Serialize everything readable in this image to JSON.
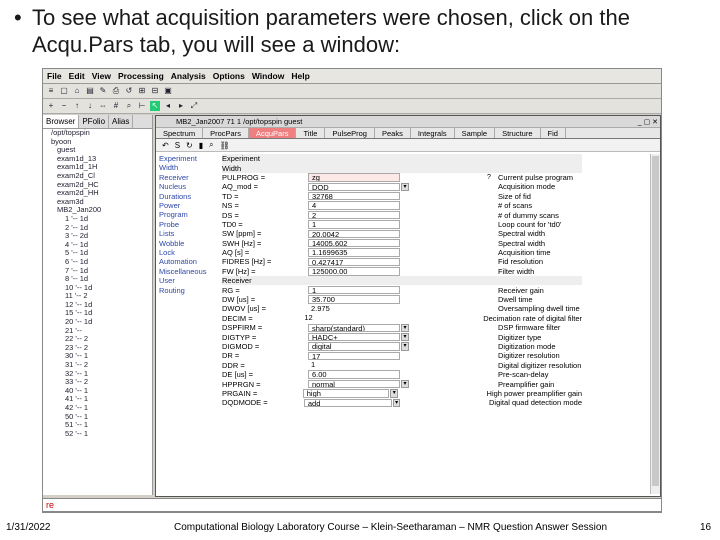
{
  "slide": {
    "bullet": "To see what acquisition parameters were chosen, click on the Acqu.Pars tab, you will see a window:",
    "date": "1/31/2022",
    "footer": "Computational Biology Laboratory Course – Klein-Seetharaman – NMR Question Answer Session",
    "page": "16"
  },
  "app": {
    "menu": [
      "File",
      "Edit",
      "View",
      "Processing",
      "Analysis",
      "Options",
      "Window",
      "Help"
    ],
    "browser_tabs": [
      "Browser",
      "PFolio",
      "Alias"
    ],
    "tree": [
      "/opt/topspin",
      "byoon",
      "guest",
      "exam1d_13",
      "exam1d_1H",
      "exam2d_Cl",
      "exam2d_HC",
      "exam2d_HH",
      "exam3d",
      "MB2_Jan200",
      "1 '-- 1d",
      "2 '-- 1d",
      "3 '-- 2d",
      "4 '-- 1d",
      "5 '-- 1d",
      "6 '-- 1d",
      "7 '-- 1d",
      "8 '-- 1d",
      "10 '-- 1d",
      "11 '-- 2",
      "12 '-- 1d",
      "15 '-- 1d",
      "20 '-- 1d",
      "21 '--",
      "22 '-- 2",
      "23 '-- 2",
      "30 '-- 1",
      "31 '-- 2",
      "32 '-- 1",
      "33 '-- 2",
      "40 '-- 1",
      "41 '-- 1",
      "42 '-- 1",
      "50 '-- 1",
      "51 '-- 1",
      "52 '-- 1"
    ],
    "window_title": "MB2_Jan2007  71  1  /opt/topspin  guest",
    "param_tabs": [
      "Spectrum",
      "ProcPars",
      "AcquPars",
      "Title",
      "PulseProg",
      "Peaks",
      "Integrals",
      "Sample",
      "Structure",
      "Fid"
    ],
    "active_tab": "AcquPars",
    "categories": [
      "Experiment",
      "Width",
      "Receiver",
      "Nucleus",
      "Durations",
      "Power",
      "Program",
      "Probe",
      "Lists",
      "Wobble",
      "Lock",
      "Automation",
      "Miscellaneous",
      "User",
      "Routing"
    ],
    "params": [
      {
        "section": "Experiment"
      },
      {
        "section": "Width"
      },
      {
        "label": "PULPROG =",
        "value": "zg",
        "desc": "Current pulse program",
        "q": "?"
      },
      {
        "label": "AQ_mod =",
        "value": "DQD",
        "desc": "Acquisition mode",
        "dd": true
      },
      {
        "label": "TD =",
        "value": "32768",
        "desc": "Size of fid"
      },
      {
        "label": "NS =",
        "value": "4",
        "desc": "# of scans"
      },
      {
        "label": "DS =",
        "value": "2",
        "desc": "# of dummy scans"
      },
      {
        "label": "TD0 =",
        "value": "1",
        "desc": "Loop count for 'td0'"
      },
      {
        "label": "SW [ppm] =",
        "value": "20.0042",
        "desc": "Spectral width"
      },
      {
        "label": "SWH [Hz] =",
        "value": "14005.602",
        "desc": "Spectral width"
      },
      {
        "label": "AQ [s] =",
        "value": "1.1699635",
        "desc": "Acquisition time"
      },
      {
        "label": "FIDRES [Hz] =",
        "value": "0.427417",
        "desc": "Fid resolution"
      },
      {
        "label": "FW [Hz] =",
        "value": "125000.00",
        "desc": "Filter width"
      },
      {
        "section": "Receiver"
      },
      {
        "label": "RG =",
        "value": "1",
        "desc": "Receiver gain"
      },
      {
        "label": "DW [us] =",
        "value": "35.700",
        "desc": "Dwell time"
      },
      {
        "label": "DWOV [us] =",
        "value": "2.975",
        "desc": "Oversampling dwell time",
        "plain": true
      },
      {
        "label": "DECIM =",
        "value": "12",
        "desc": "Decimation rate of digital filter",
        "plain": true
      },
      {
        "label": "DSPFIRM =",
        "value": "sharp(standard)",
        "desc": "DSP firmware filter",
        "dd": true
      },
      {
        "label": "DIGTYP =",
        "value": "HADC+",
        "desc": "Digitizer type",
        "dd": true
      },
      {
        "label": "DIGMOD =",
        "value": "digital",
        "desc": "Digitization mode",
        "dd": true
      },
      {
        "label": "DR =",
        "value": "17",
        "desc": "Digitizer resolution"
      },
      {
        "label": "DDR =",
        "value": "1",
        "desc": "Digital digitizer resolution",
        "plain": true
      },
      {
        "label": "DE [us] =",
        "value": "6.00",
        "desc": "Pre-scan-delay"
      },
      {
        "label": "HPPRGN =",
        "value": "normal",
        "desc": "Preamplifier gain",
        "dd": true
      },
      {
        "label": "PRGAIN =",
        "value": "high",
        "desc": "High power preamplifier gain",
        "dd": true
      },
      {
        "label": "DQDMODE =",
        "value": "add",
        "desc": "Digital quad detection mode",
        "dd": true
      }
    ],
    "command_line": "re"
  }
}
